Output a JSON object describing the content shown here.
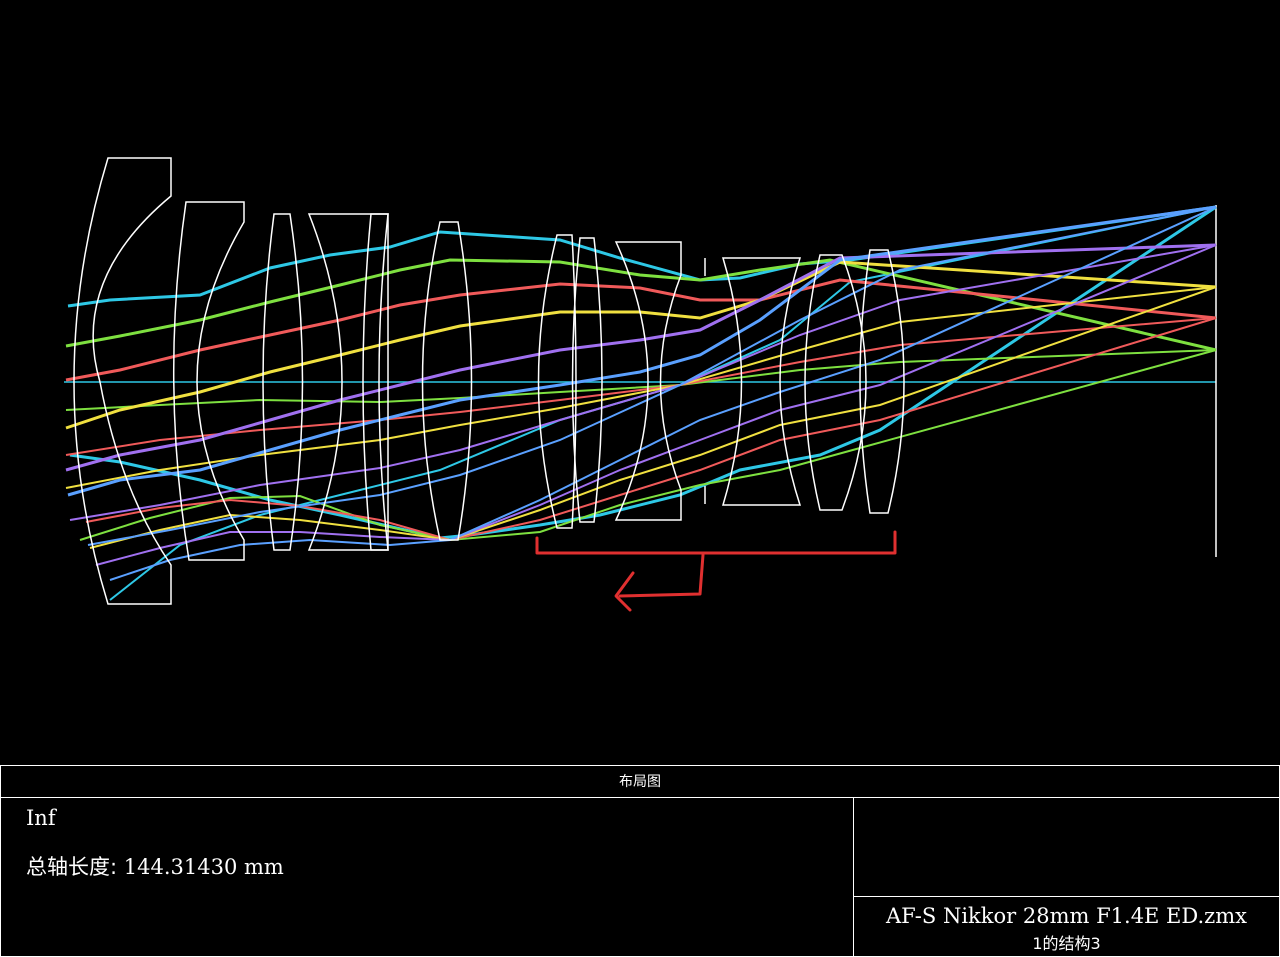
{
  "panel": {
    "title": "布局图",
    "field": "Inf",
    "axis_length_label": "总轴长度:",
    "axis_length_value": " 144.31430 mm",
    "file_name": "AF-S Nikkor 28mm F1.4E ED.zmx",
    "config": "1的结构3"
  },
  "colors": {
    "background": "#000000",
    "lens": "#ffffff",
    "annotation": "#e03030",
    "rays": [
      "#2ec8e6",
      "#7ee040",
      "#f05a5a",
      "#f0e040",
      "#a070f0",
      "#5aa0ff"
    ]
  }
}
